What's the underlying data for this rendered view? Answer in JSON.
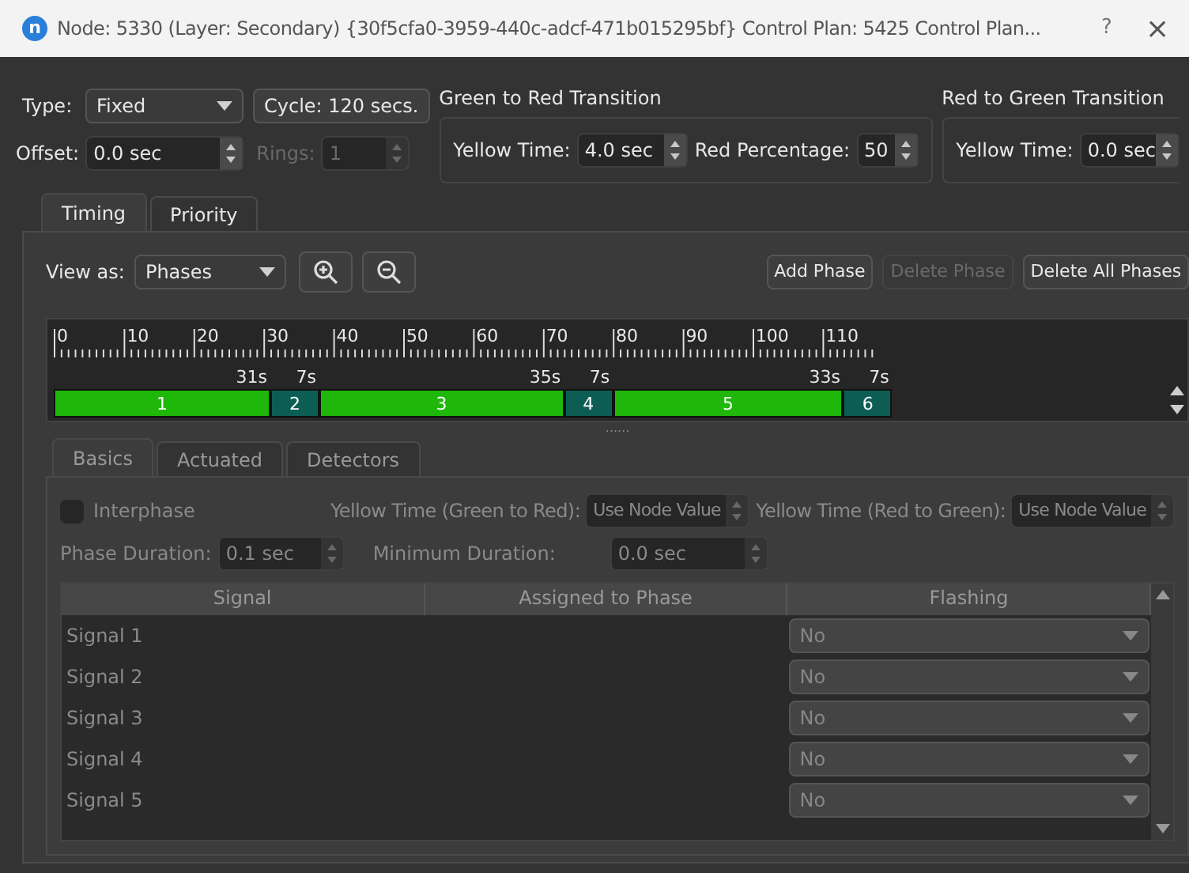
{
  "title_bar": {
    "icon_letter": "n",
    "title": "Node: 5330 (Layer: Secondary) {30f5cfa0-3959-440c-adcf-471b015295bf} Control Plan: 5425 Control Plan...",
    "help": "?",
    "close": "×"
  },
  "plan": {
    "type_label": "Type:",
    "type_value": "Fixed",
    "cycle_button": "Cycle: 120 secs.",
    "offset_label": "Offset:",
    "offset_value": "0.0 sec",
    "rings_label": "Rings:",
    "rings_value": "1",
    "rings_disabled": true
  },
  "green_to_red": {
    "title": "Green to Red Transition",
    "yellow_label": "Yellow Time:",
    "yellow_value": "4.0 sec",
    "red_label": "Red Percentage:",
    "red_value": "50"
  },
  "red_to_green": {
    "title": "Red to Green Transition",
    "yellow_label": "Yellow Time:",
    "yellow_value": "0.0 sec"
  },
  "tabs": [
    {
      "label": "Timing",
      "selected": true
    },
    {
      "label": "Priority",
      "selected": false
    }
  ],
  "timing": {
    "view_label": "View as:",
    "view_value": "Phases",
    "buttons": [
      {
        "label": "Add Phase",
        "disabled": false
      },
      {
        "label": "Delete Phase",
        "disabled": true
      },
      {
        "label": "Delete All Phases",
        "disabled": false
      }
    ],
    "ruler": [
      "0",
      "10",
      "20",
      "30",
      "40",
      "50",
      "60",
      "70",
      "80",
      "90",
      "100",
      "110"
    ],
    "phases": [
      {
        "number": "1",
        "duration": "31s",
        "color": "#1fb80a"
      },
      {
        "number": "2",
        "duration": "7s",
        "color": "#0c5e54"
      },
      {
        "number": "3",
        "duration": "35s",
        "color": "#1fb80a"
      },
      {
        "number": "4",
        "duration": "7s",
        "color": "#0c5e54"
      },
      {
        "number": "5",
        "duration": "33s",
        "color": "#1fb80a"
      },
      {
        "number": "6",
        "duration": "7s",
        "color": "#0c5e54"
      }
    ],
    "splitter": "......"
  },
  "phase_tabs": [
    {
      "label": "Basics",
      "selected": true
    },
    {
      "label": "Actuated",
      "selected": false
    },
    {
      "label": "Detectors",
      "selected": false
    }
  ],
  "phase_details": {
    "disabled": true,
    "interphase_label": "Interphase",
    "interphase_checked": false,
    "yellow_g2r_label": "Yellow Time (Green to Red):",
    "yellow_g2r_value": "Use Node Value",
    "yellow_r2g_label": "Yellow Time (Red to Green):",
    "yellow_r2g_value": "Use Node Value",
    "duration_label": "Phase Duration:",
    "duration_value": "0.1 sec",
    "min_label": "Minimum Duration:",
    "min_value": "0.0 sec",
    "columns": [
      "Signal",
      "Assigned to Phase",
      "Flashing"
    ],
    "rows": [
      {
        "signal": "Signal 1",
        "flashing": "No"
      },
      {
        "signal": "Signal 2",
        "flashing": "No"
      },
      {
        "signal": "Signal 3",
        "flashing": "No"
      },
      {
        "signal": "Signal 4",
        "flashing": "No"
      },
      {
        "signal": "Signal 5",
        "flashing": "No"
      }
    ]
  }
}
